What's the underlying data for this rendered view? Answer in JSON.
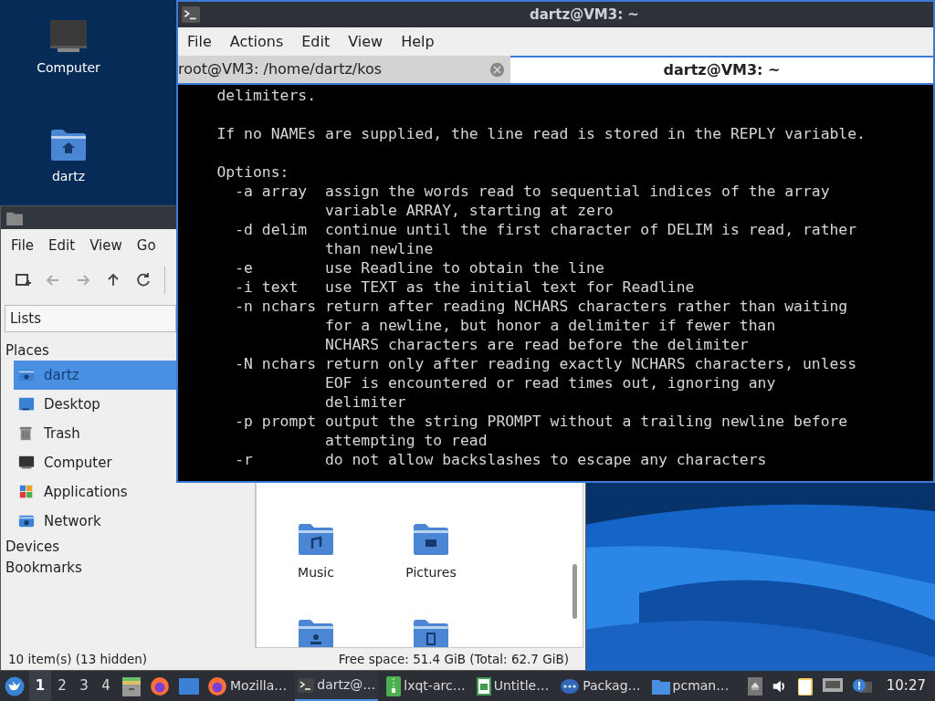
{
  "desktop_icons": [
    {
      "label": "Computer"
    },
    {
      "label": "dartz"
    }
  ],
  "terminal": {
    "title": "dartz@VM3: ~",
    "menu": [
      "File",
      "Actions",
      "Edit",
      "View",
      "Help"
    ],
    "tabs": [
      {
        "label": "root@VM3: /home/dartz/kos",
        "selected": false
      },
      {
        "label": "dartz@VM3: ~",
        "selected": true
      }
    ],
    "blocks": [
      [
        "    delimiters."
      ],
      [
        "    If no NAMEs are supplied, the line read is stored in the REPLY variable."
      ],
      [
        "    Options:",
        "      -a array  assign the words read to sequential indices of the array",
        "                variable ARRAY, starting at zero",
        "      -d delim  continue until the first character of DELIM is read, rather",
        "                than newline",
        "      -e        use Readline to obtain the line",
        "      -i text   use TEXT as the initial text for Readline",
        "      -n nchars return after reading NCHARS characters rather than waiting",
        "                for a newline, but honor a delimiter if fewer than",
        "                NCHARS characters are read before the delimiter",
        "      -N nchars return only after reading exactly NCHARS characters, unless",
        "                EOF is encountered or read times out, ignoring any",
        "                delimiter",
        "      -p prompt output the string PROMPT without a trailing newline before",
        "                attempting to read",
        "      -r        do not allow backslashes to escape any characters"
      ]
    ]
  },
  "file_manager": {
    "menu": [
      "File",
      "Edit",
      "View",
      "Go"
    ],
    "toolbar": [
      {
        "disabled": false
      },
      {
        "disabled": true
      },
      {
        "disabled": true
      },
      {
        "disabled": false
      },
      {
        "disabled": false
      }
    ],
    "side_pane_mode": "Lists",
    "sections": [
      {
        "label": "Places",
        "children": [
          {
            "label": "dartz",
            "selected": true
          },
          {
            "label": "Desktop",
            "selected": false
          },
          {
            "label": "Trash",
            "selected": false
          },
          {
            "label": "Computer",
            "selected": false
          },
          {
            "label": "Applications",
            "selected": false
          },
          {
            "label": "Network",
            "selected": false
          }
        ]
      },
      {
        "label": "Devices"
      },
      {
        "label": "Bookmarks"
      }
    ],
    "folders": [
      {
        "label": "Music"
      },
      {
        "label": "Pictures"
      }
    ],
    "status_left": "10 item(s) (13 hidden)",
    "status_right": "Free space: 51.4 GiB (Total: 62.7 GiB)"
  },
  "taskbar": {
    "desktops": [
      {
        "label": "1",
        "selected": true
      },
      {
        "label": "2",
        "selected": false
      },
      {
        "label": "3",
        "selected": false
      },
      {
        "label": "4",
        "selected": false
      }
    ],
    "tasks": [
      {
        "label": "Mozilla…",
        "active": false
      },
      {
        "label": "dartz@…",
        "active": true
      },
      {
        "label": "lxqt-arc…",
        "active": false
      },
      {
        "label": "Untitle…",
        "active": false
      },
      {
        "label": "Packag…",
        "active": false
      },
      {
        "label": "pcman…",
        "active": false
      }
    ],
    "clock": "10:27"
  }
}
